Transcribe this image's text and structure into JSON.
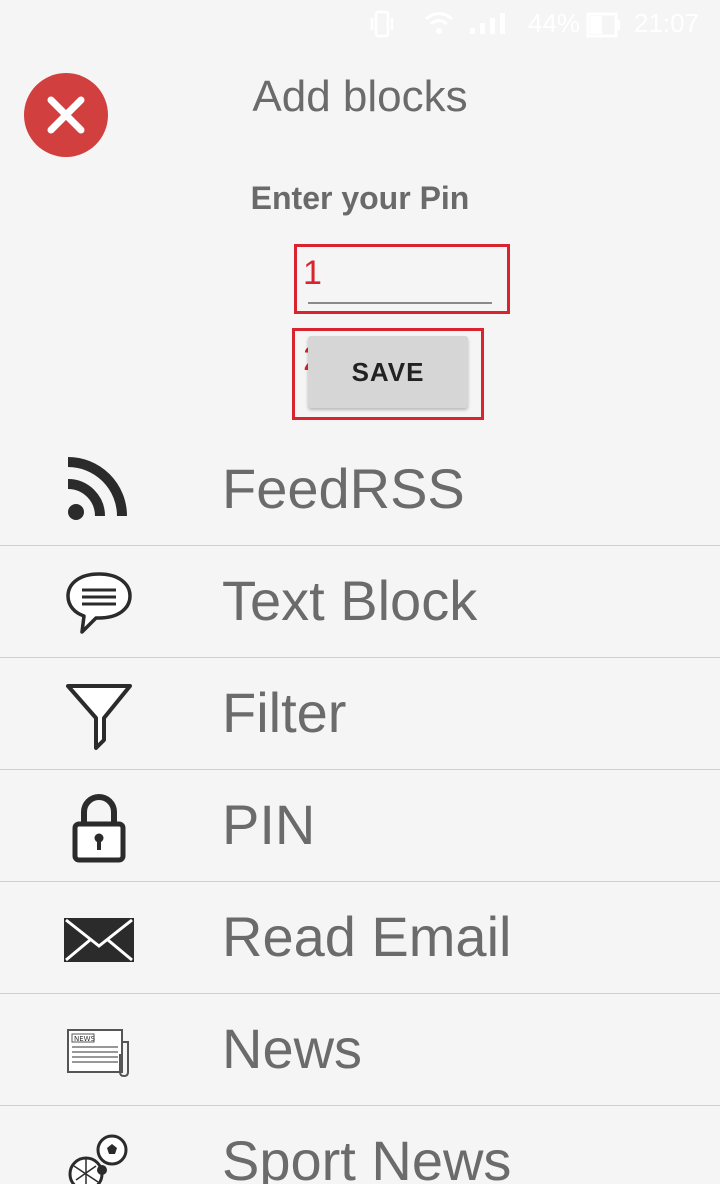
{
  "status_bar": {
    "battery_percent": "44%",
    "time": "21:07",
    "icons": [
      "vibrate-icon",
      "wifi-icon",
      "signal-icon",
      "battery-icon"
    ]
  },
  "header": {
    "title": "Add blocks",
    "close_icon": "close-icon"
  },
  "pin_form": {
    "label": "Enter your Pin",
    "input_value": "",
    "save_label": "SAVE",
    "annotations": [
      "1",
      "2"
    ]
  },
  "blocks": [
    {
      "label": "FeedRSS",
      "icon": "rss-icon"
    },
    {
      "label": "Text Block",
      "icon": "chat-bubble-icon"
    },
    {
      "label": "Filter",
      "icon": "filter-icon"
    },
    {
      "label": "PIN",
      "icon": "lock-icon"
    },
    {
      "label": "Read Email",
      "icon": "envelope-icon"
    },
    {
      "label": "News",
      "icon": "newspaper-icon"
    },
    {
      "label": "Sport News",
      "icon": "sports-icon"
    }
  ],
  "colors": {
    "close_button": "#d23f3f",
    "annotation": "#d9232e",
    "text": "#6b6b6b",
    "background": "#f5f5f5"
  }
}
